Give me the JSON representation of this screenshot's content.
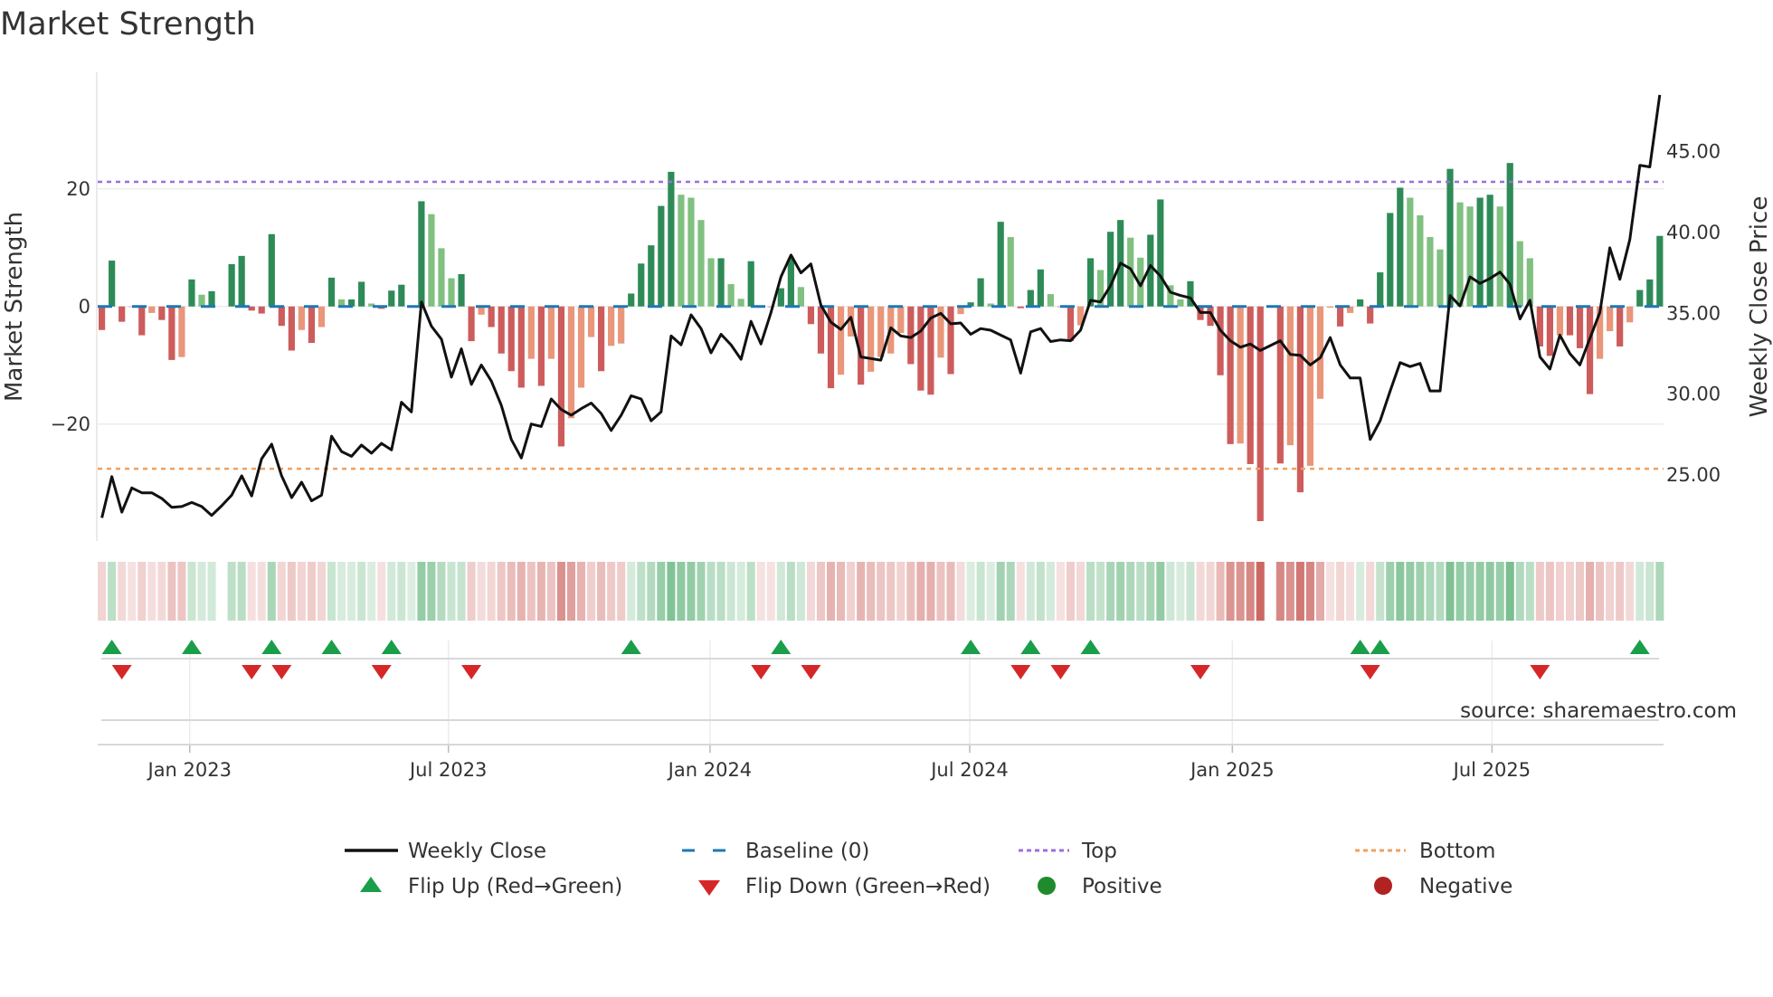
{
  "title": "Market Strength",
  "source": "source: sharemaestro.com",
  "chart_data": {
    "type": "bar",
    "title": "Market Strength",
    "ylabel": "Market Strength",
    "y2label": "Weekly Close Price",
    "ylim": [
      -38,
      37
    ],
    "y2lim": [
      21,
      50.5
    ],
    "yticks": [
      {
        "v": 20,
        "label": "20"
      },
      {
        "v": 0,
        "label": "0"
      },
      {
        "v": -20,
        "label": "−20"
      }
    ],
    "y2ticks": [
      {
        "v": 45,
        "label": "45.00"
      },
      {
        "v": 40,
        "label": "40.00"
      },
      {
        "v": 35,
        "label": "35.00"
      },
      {
        "v": 30,
        "label": "30.00"
      },
      {
        "v": 25,
        "label": "25.00"
      }
    ],
    "xticks": [
      {
        "week": 8.8,
        "label": "Jan 2023"
      },
      {
        "week": 34.7,
        "label": "Jul 2023"
      },
      {
        "week": 60.9,
        "label": "Jan 2024"
      },
      {
        "week": 86.9,
        "label": "Jul 2024"
      },
      {
        "week": 113.2,
        "label": "Jan 2025"
      },
      {
        "week": 139.2,
        "label": "Jul 2025"
      }
    ],
    "top_level": 21.2,
    "bottom_level": -27.6,
    "baseline": 0,
    "strength": [
      -4.0,
      7.8,
      -2.6,
      -0.1,
      -4.9,
      -1.1,
      -2.3,
      -9.1,
      -8.6,
      4.6,
      2.0,
      2.6,
      0,
      7.2,
      8.6,
      -0.7,
      -1.2,
      12.3,
      -3.3,
      -7.5,
      -4.0,
      -6.2,
      -3.5,
      4.9,
      1.2,
      1.2,
      4.2,
      0.5,
      -0.4,
      2.7,
      3.7,
      0.1,
      17.9,
      15.7,
      9.9,
      4.8,
      5.5,
      -5.9,
      -1.4,
      -3.5,
      -8.0,
      -11.0,
      -13.8,
      -8.9,
      -13.5,
      -8.9,
      -23.8,
      -19.0,
      -13.8,
      -5.2,
      -11.0,
      -6.7,
      -6.3,
      2.2,
      7.3,
      10.4,
      17.1,
      22.9,
      19.0,
      18.5,
      14.7,
      8.2,
      8.2,
      3.8,
      1.3,
      7.7,
      -0.1,
      -0.1,
      3.1,
      8.2,
      3.3,
      -3.0,
      -8.0,
      -13.9,
      -11.6,
      -5.1,
      -13.3,
      -11.1,
      -8.6,
      -8.0,
      -4.5,
      -9.8,
      -14.3,
      -15.0,
      -8.7,
      -11.5,
      -1.3,
      0.7,
      4.8,
      0.5,
      14.4,
      11.8,
      -0.3,
      2.8,
      6.3,
      2.1,
      -0.1,
      -5.9,
      -3.2,
      8.2,
      6.2,
      12.7,
      14.7,
      11.7,
      8.3,
      12.2,
      18.2,
      3.6,
      1.2,
      4.3,
      -2.3,
      -3.3,
      -11.7,
      -23.4,
      -23.3,
      -26.8,
      -36.5,
      0,
      -26.7,
      -23.6,
      -31.6,
      -27.1,
      -15.7,
      -0.2,
      -3.4,
      -1.1,
      1.2,
      -2.9,
      5.8,
      15.9,
      20.2,
      18.5,
      15.5,
      11.8,
      9.7,
      23.4,
      17.7,
      17.0,
      18.5,
      19.0,
      17.0,
      24.4,
      11.1,
      8.2,
      -6.8,
      -8.4,
      -4.9,
      -4.9,
      -7.1,
      -14.9,
      -8.9,
      -4.2,
      -6.8,
      -2.7,
      2.8,
      4.6,
      12.0
    ],
    "weekly_close": [
      22.35,
      24.9,
      22.7,
      24.2,
      23.9,
      23.9,
      23.55,
      23.0,
      23.05,
      23.3,
      23.05,
      22.5,
      23.1,
      23.75,
      24.95,
      23.7,
      26.0,
      26.9,
      24.95,
      23.6,
      24.55,
      23.4,
      23.75,
      27.4,
      26.45,
      26.15,
      26.85,
      26.35,
      26.95,
      26.55,
      29.5,
      28.9,
      35.7,
      34.2,
      33.4,
      31.05,
      32.8,
      30.6,
      31.8,
      30.8,
      29.3,
      27.2,
      26.05,
      28.15,
      28.0,
      29.7,
      29.05,
      28.7,
      29.1,
      29.45,
      28.8,
      27.75,
      28.7,
      29.9,
      29.7,
      28.35,
      28.9,
      33.6,
      33.05,
      34.9,
      34.05,
      32.55,
      33.7,
      33.05,
      32.15,
      34.5,
      33.1,
      35.05,
      37.25,
      38.6,
      37.5,
      38.05,
      35.5,
      34.45,
      34.0,
      34.75,
      32.3,
      32.2,
      32.1,
      34.1,
      33.6,
      33.5,
      33.9,
      34.7,
      35.0,
      34.35,
      34.4,
      33.7,
      34.05,
      33.95,
      33.65,
      33.35,
      31.3,
      33.85,
      34.05,
      33.25,
      33.35,
      33.3,
      33.95,
      35.8,
      35.7,
      36.7,
      38.1,
      37.75,
      36.7,
      37.95,
      37.3,
      36.3,
      36.1,
      35.95,
      35.05,
      35.05,
      33.95,
      33.3,
      32.9,
      33.1,
      32.7,
      33.0,
      33.3,
      32.45,
      32.4,
      31.8,
      32.25,
      33.5,
      31.8,
      31.0,
      31.0,
      27.2,
      28.35,
      30.2,
      31.95,
      31.7,
      31.9,
      30.2,
      30.2,
      36.1,
      35.45,
      37.25,
      36.85,
      37.15,
      37.55,
      36.8,
      34.65,
      35.8,
      32.3,
      31.55,
      33.65,
      32.5,
      31.8,
      33.45,
      35.05,
      39.05,
      37.1,
      39.55,
      44.15,
      44.05,
      48.5
    ],
    "legend": {
      "position": "bottom",
      "items": [
        {
          "key": "weekly_close",
          "label": "Weekly Close"
        },
        {
          "key": "baseline",
          "label": "Baseline (0)"
        },
        {
          "key": "top",
          "label": "Top"
        },
        {
          "key": "bottom",
          "label": "Bottom"
        },
        {
          "key": "flip_up",
          "label": "Flip Up (Red→Green)"
        },
        {
          "key": "flip_down",
          "label": "Flip Down (Green→Red)"
        },
        {
          "key": "positive",
          "label": "Positive"
        },
        {
          "key": "negative",
          "label": "Negative"
        }
      ]
    },
    "colors": {
      "pos_strong": "#2e8b57",
      "pos_weak": "#80c080",
      "neg_strong": "#cd5c5c",
      "neg_weak": "#e9967a",
      "line": "#111111",
      "baseline": "#1f77b4",
      "top": "#9b6fdc",
      "bottom": "#f0a060",
      "flip_up": "#1a9e4a",
      "flip_down": "#d62728",
      "positive": "#1f8b2c",
      "negative": "#b22222",
      "strip_pos": "#3aa05a",
      "strip_neg": "#c85a55"
    }
  }
}
